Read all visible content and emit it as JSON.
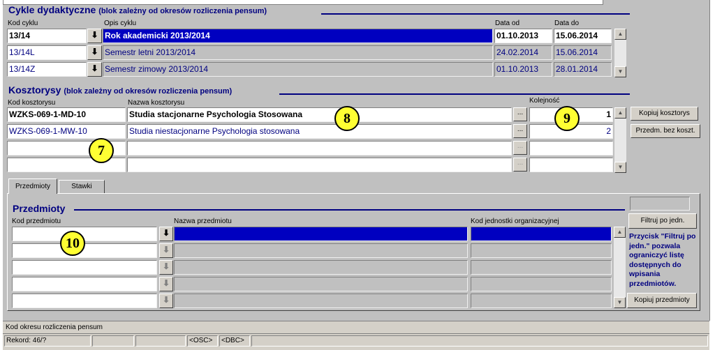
{
  "cycles": {
    "title": "Cykle dydaktyczne",
    "subtitle": "(blok zależny od okresów rozliczenia pensum)",
    "headers": {
      "kod": "Kod cyklu",
      "opis": "Opis cyklu",
      "od": "Data od",
      "do": "Data do"
    },
    "rows": [
      {
        "kod": "13/14",
        "opis": "Rok akademicki 2013/2014",
        "od": "01.10.2013",
        "do": "15.06.2014"
      },
      {
        "kod": "13/14L",
        "opis": "Semestr letni 2013/2014",
        "od": "24.02.2014",
        "do": "15.06.2014"
      },
      {
        "kod": "13/14Z",
        "opis": "Semestr zimowy 2013/2014",
        "od": "01.10.2013",
        "do": "28.01.2014"
      }
    ],
    "download_icon": "download-arrow-icon",
    "dropdown_glyph": "⬇"
  },
  "estimates": {
    "title": "Kosztorysy",
    "subtitle": "(blok zależny od okresów rozliczenia pensum)",
    "headers": {
      "kod": "Kod kosztorysu",
      "nazwa": "Nazwa kosztorysu",
      "kolejnosc": "Kolejność"
    },
    "rows": [
      {
        "kod": "WZKS-069-1-MD-10",
        "nazwa": "Studia stacjonarne Psychologia Stosowana",
        "kolejnosc": "1"
      },
      {
        "kod": "WZKS-069-1-MW-10",
        "nazwa": "Studia niestacjonarne Psychologia stosowana",
        "kolejnosc": "2"
      },
      {
        "kod": "",
        "nazwa": "",
        "kolejnosc": ""
      },
      {
        "kod": "",
        "nazwa": "",
        "kolejnosc": ""
      }
    ],
    "ellipsis": "...",
    "copy_button": "Kopiuj kosztorys",
    "nocost_button": "Przedm. bez koszt."
  },
  "tabs": [
    {
      "label": "Przedmioty"
    },
    {
      "label": "Stawki"
    }
  ],
  "subjects": {
    "title": "Przedmioty",
    "headers": {
      "kod": "Kod przedmiotu",
      "nazwa": "Nazwa przedmiotu",
      "jedn": "Kod jednostki organizacyjnej"
    },
    "row_count": 5,
    "filter_button": "Filtruj po jedn.",
    "note": "Przycisk \"Filtruj po jedn.\" pozwala ograniczyć listę dostępnych do wpisania przedmiotów.",
    "copy_button": "Kopiuj przedmioty"
  },
  "badges": {
    "b7": "7",
    "b8": "8",
    "b9": "9",
    "b10": "10"
  },
  "status": {
    "field_hint": "Kod okresu rozliczenia pensum",
    "record": "Rekord: 46/?",
    "osc": "<OSC>",
    "dbc": "<DBC>"
  },
  "scroll_up_glyph": "▲",
  "scroll_down_glyph": "▼"
}
